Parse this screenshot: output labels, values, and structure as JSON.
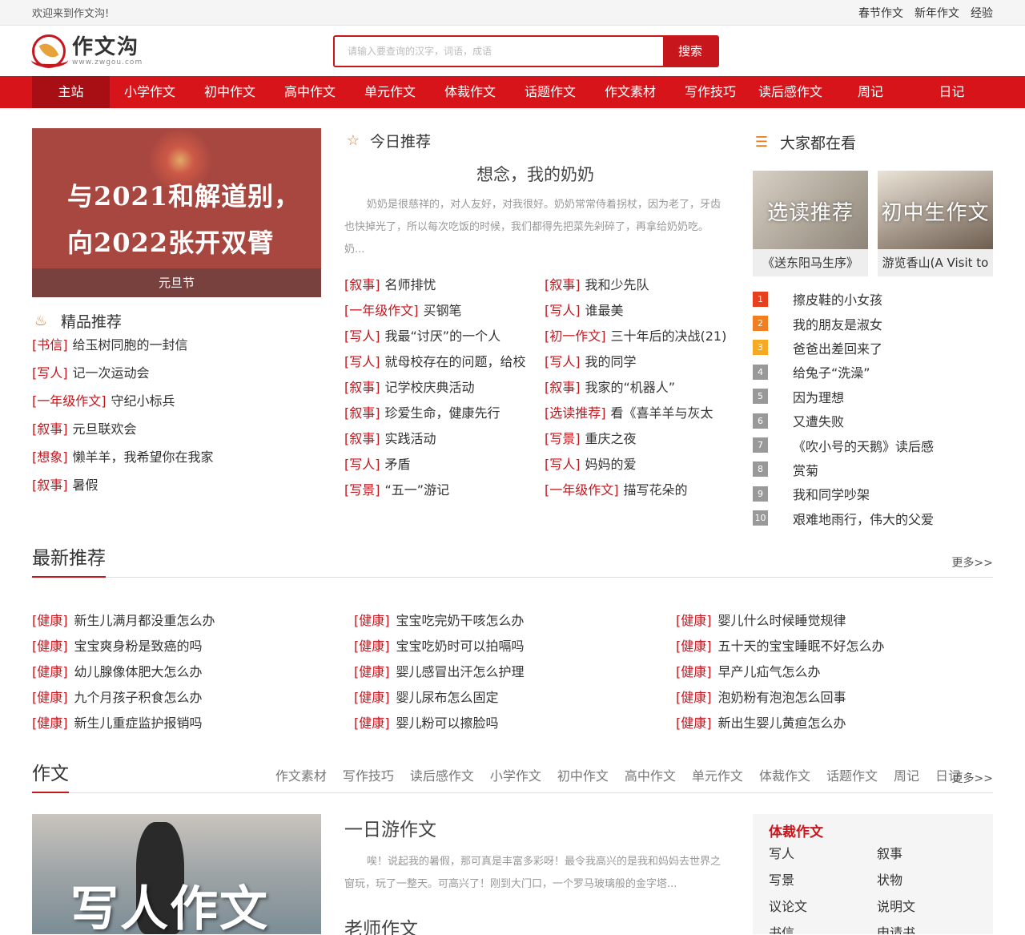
{
  "topbar": {
    "welcome": "欢迎来到作文沟!",
    "links": [
      "春节作文",
      "新年作文",
      "经验"
    ]
  },
  "logo": {
    "name": "作文沟",
    "url": "www.zwgou.com"
  },
  "search": {
    "placeholder": "请输入要查询的汉字，词语，成语",
    "button": "搜索"
  },
  "nav": [
    "主站",
    "小学作文",
    "初中作文",
    "高中作文",
    "单元作文",
    "体裁作文",
    "话题作文",
    "作文素材",
    "写作技巧",
    "读后感作文",
    "周记",
    "日记"
  ],
  "banner": {
    "line1": "与2021和解道别，",
    "line2": "向2022张开双臂",
    "caption": "元旦节"
  },
  "featured": {
    "title": "精品推荐",
    "items": [
      {
        "tag": "[书信]",
        "text": "给玉树同胞的一封信"
      },
      {
        "tag": "[写人]",
        "text": "记一次运动会"
      },
      {
        "tag": "[一年级作文]",
        "text": "守纪小标兵"
      },
      {
        "tag": "[叙事]",
        "text": "元旦联欢会"
      },
      {
        "tag": "[想象]",
        "text": "懒羊羊，我希望你在我家"
      },
      {
        "tag": "[叙事]",
        "text": "暑假"
      }
    ]
  },
  "today": {
    "title": "今日推荐",
    "headline": "想念，我的奶奶",
    "summary": "奶奶是很慈祥的，对人友好，对我很好。奶奶常常侍着拐杖，因为老了，牙齿也快掉光了，所以每次吃饭的时候，我们都得先把菜先剁碎了，再拿给奶奶吃。奶...",
    "items": [
      {
        "tag": "[叙事]",
        "text": "名师排忧"
      },
      {
        "tag": "[叙事]",
        "text": "我和少先队"
      },
      {
        "tag": "[一年级作文]",
        "text": "买钢笔"
      },
      {
        "tag": "[写人]",
        "text": "谁最美"
      },
      {
        "tag": "[写人]",
        "text": "我最“讨厌”的一个人"
      },
      {
        "tag": "[初一作文]",
        "text": "三十年后的决战(21)"
      },
      {
        "tag": "[写人]",
        "text": "就母校存在的问题，给校"
      },
      {
        "tag": "[写人]",
        "text": "我的同学"
      },
      {
        "tag": "[叙事]",
        "text": "记学校庆典活动"
      },
      {
        "tag": "[叙事]",
        "text": "我家的“机器人”"
      },
      {
        "tag": "[叙事]",
        "text": "珍爱生命，健康先行"
      },
      {
        "tag": "[选读推荐]",
        "text": "看《喜羊羊与灰太"
      },
      {
        "tag": "[叙事]",
        "text": "实践活动"
      },
      {
        "tag": "[写景]",
        "text": "重庆之夜"
      },
      {
        "tag": "[写人]",
        "text": "矛盾"
      },
      {
        "tag": "[写人]",
        "text": "妈妈的爱"
      },
      {
        "tag": "[写景]",
        "text": "“五一”游记"
      },
      {
        "tag": "[一年级作文]",
        "text": "描写花朵的"
      }
    ]
  },
  "popular": {
    "title": "大家都在看",
    "thumbs": [
      {
        "overlay": "选读推荐",
        "caption": "《送东阳马生序》"
      },
      {
        "overlay": "初中生作文",
        "caption": "游览香山(A Visit to"
      }
    ],
    "ranking": [
      "擦皮鞋的小女孩",
      "我的朋友是淑女",
      "爸爸出差回来了",
      "给兔子“洗澡”",
      "因为理想",
      "又遭失败",
      "《吹小号的天鹅》读后感",
      "赏菊",
      "我和同学吵架",
      "艰难地雨行，伟大的父爱"
    ]
  },
  "latest": {
    "title": "最新推荐",
    "more": "更多>>",
    "columns": [
      [
        {
          "tag": "[健康]",
          "text": "新生儿满月都没重怎么办"
        },
        {
          "tag": "[健康]",
          "text": "宝宝爽身粉是致癌的吗"
        },
        {
          "tag": "[健康]",
          "text": "幼儿腺像体肥大怎么办"
        },
        {
          "tag": "[健康]",
          "text": "九个月孩子积食怎么办"
        },
        {
          "tag": "[健康]",
          "text": "新生儿重症监护报销吗"
        }
      ],
      [
        {
          "tag": "[健康]",
          "text": "宝宝吃完奶干咳怎么办"
        },
        {
          "tag": "[健康]",
          "text": "宝宝吃奶时可以拍嗝吗"
        },
        {
          "tag": "[健康]",
          "text": "婴儿感冒出汗怎么护理"
        },
        {
          "tag": "[健康]",
          "text": "婴儿尿布怎么固定"
        },
        {
          "tag": "[健康]",
          "text": "婴儿粉可以擦脸吗"
        }
      ],
      [
        {
          "tag": "[健康]",
          "text": "婴儿什么时候睡觉规律"
        },
        {
          "tag": "[健康]",
          "text": "五十天的宝宝睡眠不好怎么办"
        },
        {
          "tag": "[健康]",
          "text": "早产儿疝气怎么办"
        },
        {
          "tag": "[健康]",
          "text": "泡奶粉有泡泡怎么回事"
        },
        {
          "tag": "[健康]",
          "text": "新出生婴儿黄疸怎么办"
        }
      ]
    ]
  },
  "zuowen": {
    "title": "作文",
    "more": "更多>>",
    "tabs": [
      "作文素材",
      "写作技巧",
      "读后感作文",
      "小学作文",
      "初中作文",
      "高中作文",
      "单元作文",
      "体裁作文",
      "话题作文",
      "周记",
      "日记"
    ],
    "image_text": "写人作文",
    "article1": {
      "title": "一日游作文",
      "summary": "唉！说起我的暑假，那可真是丰富多彩呀！最令我高兴的是我和妈妈去世界之窗玩，玩了一整天。可高兴了！刚到大门口，一个罗马玻璃般的金字塔..."
    },
    "article2_title": "老师作文",
    "side": {
      "title": "体裁作文",
      "items": [
        "写人",
        "叙事",
        "写景",
        "状物",
        "议论文",
        "说明文",
        "书信",
        "申请书"
      ]
    }
  },
  "colors": {
    "brand": "#c8161d",
    "nav": "#d8141b"
  }
}
